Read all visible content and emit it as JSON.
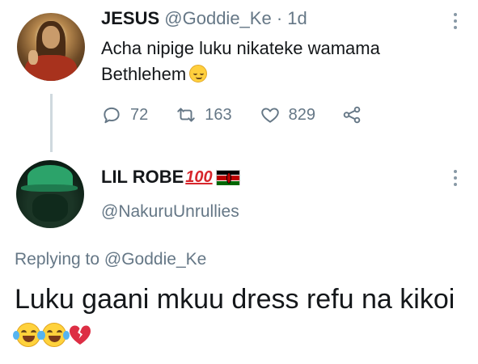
{
  "original_tweet": {
    "author_name": "JESUS",
    "handle": "@Goddie_Ke",
    "separator": "·",
    "time": "1d",
    "text": "Acha nipige luku nikateke wamama Bethlehem",
    "emoji": "relieved-face",
    "stats": {
      "replies": "72",
      "retweets": "163",
      "likes": "829"
    }
  },
  "reply_tweet": {
    "author_name": "LIL ROBE",
    "name_badges": [
      "100",
      "kenya-flag"
    ],
    "handle": "@NakuruUnrullies",
    "replying_label": "Replying to",
    "replying_to": "@Goddie_Ke",
    "text": "Luku gaani mkuu dress refu na kikoi",
    "emojis": [
      "face-with-tears-of-joy",
      "face-with-tears-of-joy",
      "broken-heart"
    ]
  },
  "colors": {
    "text": "#14171a",
    "muted": "#657786",
    "thread_line": "#cfd9de",
    "menu_dots": "#8899a6"
  }
}
